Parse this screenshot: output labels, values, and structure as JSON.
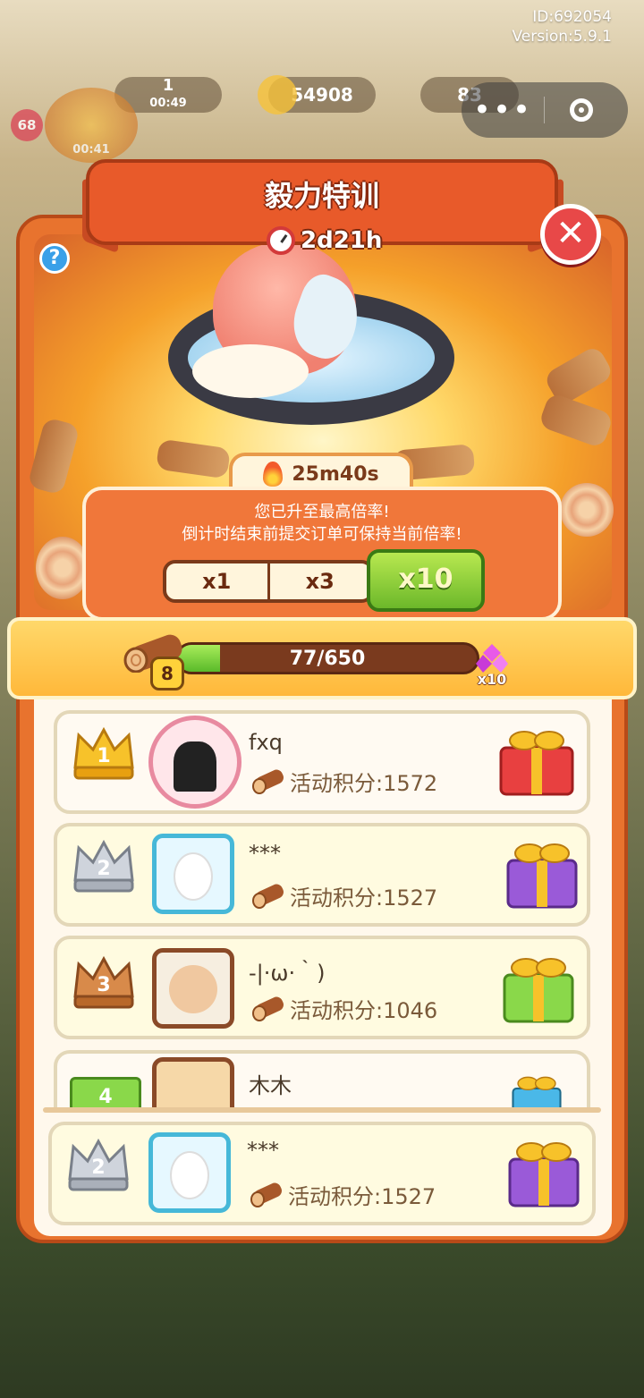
{
  "meta": {
    "id": "ID:692054",
    "version": "Version:5.9.1"
  },
  "hud": {
    "lives_count": "1",
    "lives_timer": "00:49",
    "coins": "54908",
    "gems": "83",
    "level": "68",
    "badge_timer": "00:41"
  },
  "event": {
    "title": "毅力特训",
    "countdown": "2d21h",
    "boost_timer": "25m40s",
    "message_line1": "您已升至最高倍率!",
    "message_line2": "倒计时结束前提交订单可保持当前倍率!",
    "multipliers": [
      "x1",
      "x3",
      "x10"
    ],
    "active_multiplier": "x10"
  },
  "progress": {
    "current": 77,
    "target": 650,
    "label": "77/650",
    "fraction": 0.118,
    "level": "8",
    "reward_label": "x10"
  },
  "ranking": [
    {
      "rank": "1",
      "name": "fxq",
      "score": "活动积分:1572",
      "gift": "red"
    },
    {
      "rank": "2",
      "name": "***",
      "score": "活动积分:1527",
      "gift": "purple"
    },
    {
      "rank": "3",
      "name": "-|·ω·｀)",
      "score": "活动积分:1046",
      "gift": "green"
    },
    {
      "rank": "4",
      "name": "木木",
      "score": "",
      "gift": "blue"
    }
  ],
  "my_rank": {
    "rank": "2",
    "name": "***",
    "score": "活动积分:1527",
    "gift": "purple"
  },
  "colors": {
    "panel": "#e8732e",
    "accent_green": "#6cb82a",
    "ribbon": "#e85a2a",
    "close": "#e84848"
  },
  "icons": [
    "clock-icon",
    "fire-icon",
    "close-icon",
    "help-icon",
    "log-icon",
    "gem-icon",
    "crown-icon",
    "gift-icon"
  ]
}
